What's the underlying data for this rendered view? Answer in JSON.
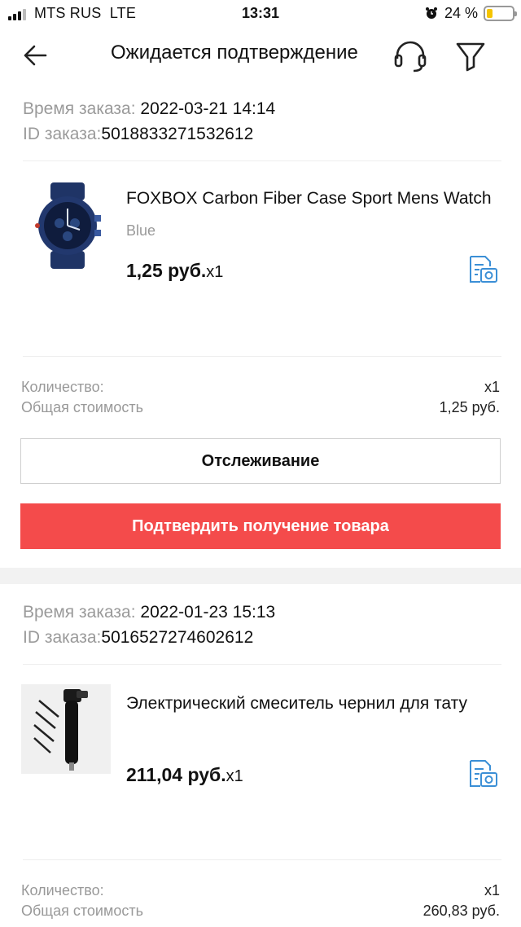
{
  "status_bar": {
    "carrier": "MTS RUS",
    "network": "LTE",
    "time": "13:31",
    "battery_percent": "24 %",
    "battery_level": 0.24,
    "battery_color": "#f5c400"
  },
  "header": {
    "title": "Ожидается подтверждение",
    "icons": [
      "back-arrow-icon",
      "headset-icon",
      "filter-icon"
    ]
  },
  "orders": [
    {
      "time_label": "Время заказа:",
      "time_value": " 2022-03-21 14:14",
      "id_label": "ID заказа:",
      "id_value": "5018833271532612",
      "product": {
        "title": "FOXBOX Carbon Fiber Case Sport Mens Watch",
        "variant": "Blue",
        "price": "1,25 руб.",
        "qty": "x1"
      },
      "quantity_label": "Количество:",
      "quantity_value": "x1",
      "total_label": "Общая стоимость",
      "total_value": "1,25 руб.",
      "track_label": "Отслеживание",
      "confirm_label": "Подтвердить получение товара"
    },
    {
      "time_label": "Время заказа:",
      "time_value": " 2022-01-23 15:13",
      "id_label": "ID заказа:",
      "id_value": "5016527274602612",
      "product": {
        "title": "Электрический смеситель чернил для тату",
        "price": "211,04 руб.",
        "qty": "x1"
      },
      "quantity_label": "Количество:",
      "quantity_value": "x1",
      "total_label": "Общая стоимость",
      "total_value": "260,83 руб."
    }
  ],
  "colors": {
    "accent": "#f44b4b",
    "icon_blue": "#3b8fd6"
  }
}
